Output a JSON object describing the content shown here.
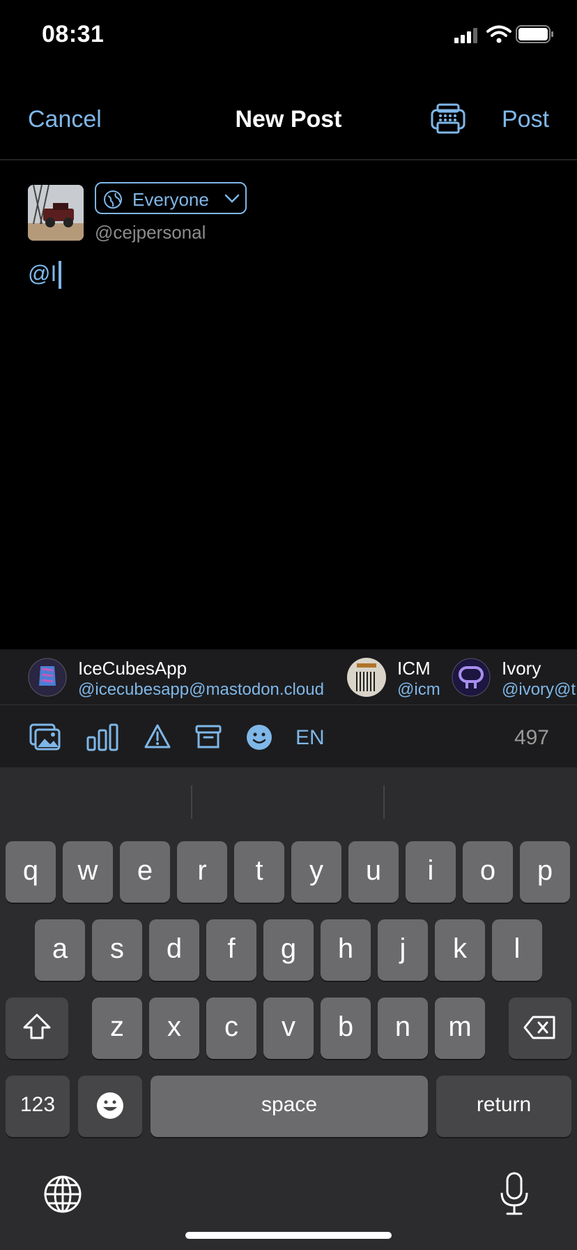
{
  "status_bar": {
    "time": "08:31"
  },
  "nav": {
    "cancel_label": "Cancel",
    "title": "New Post",
    "post_label": "Post"
  },
  "composer": {
    "visibility": "Everyone",
    "handle": "@cejpersonal",
    "draft_text": "@I"
  },
  "suggestions": [
    {
      "name": "IceCubesApp",
      "handle": "@icecubesapp@mastodon.cloud"
    },
    {
      "name": "ICM",
      "handle": "@icm"
    },
    {
      "name": "Ivory",
      "handle": "@ivory@t"
    }
  ],
  "toolbar": {
    "language": "EN",
    "char_count": "497"
  },
  "keyboard": {
    "row1": [
      "q",
      "w",
      "e",
      "r",
      "t",
      "y",
      "u",
      "i",
      "o",
      "p"
    ],
    "row2": [
      "a",
      "s",
      "d",
      "f",
      "g",
      "h",
      "j",
      "k",
      "l"
    ],
    "row3": [
      "z",
      "x",
      "c",
      "v",
      "b",
      "n",
      "m"
    ],
    "numbers_label": "123",
    "space_label": "space",
    "return_label": "return"
  },
  "colors": {
    "accent": "#7fb7e8",
    "background": "#000000",
    "keyboard_bg": "#2c2c2e",
    "key_bg": "#6b6b6d"
  }
}
